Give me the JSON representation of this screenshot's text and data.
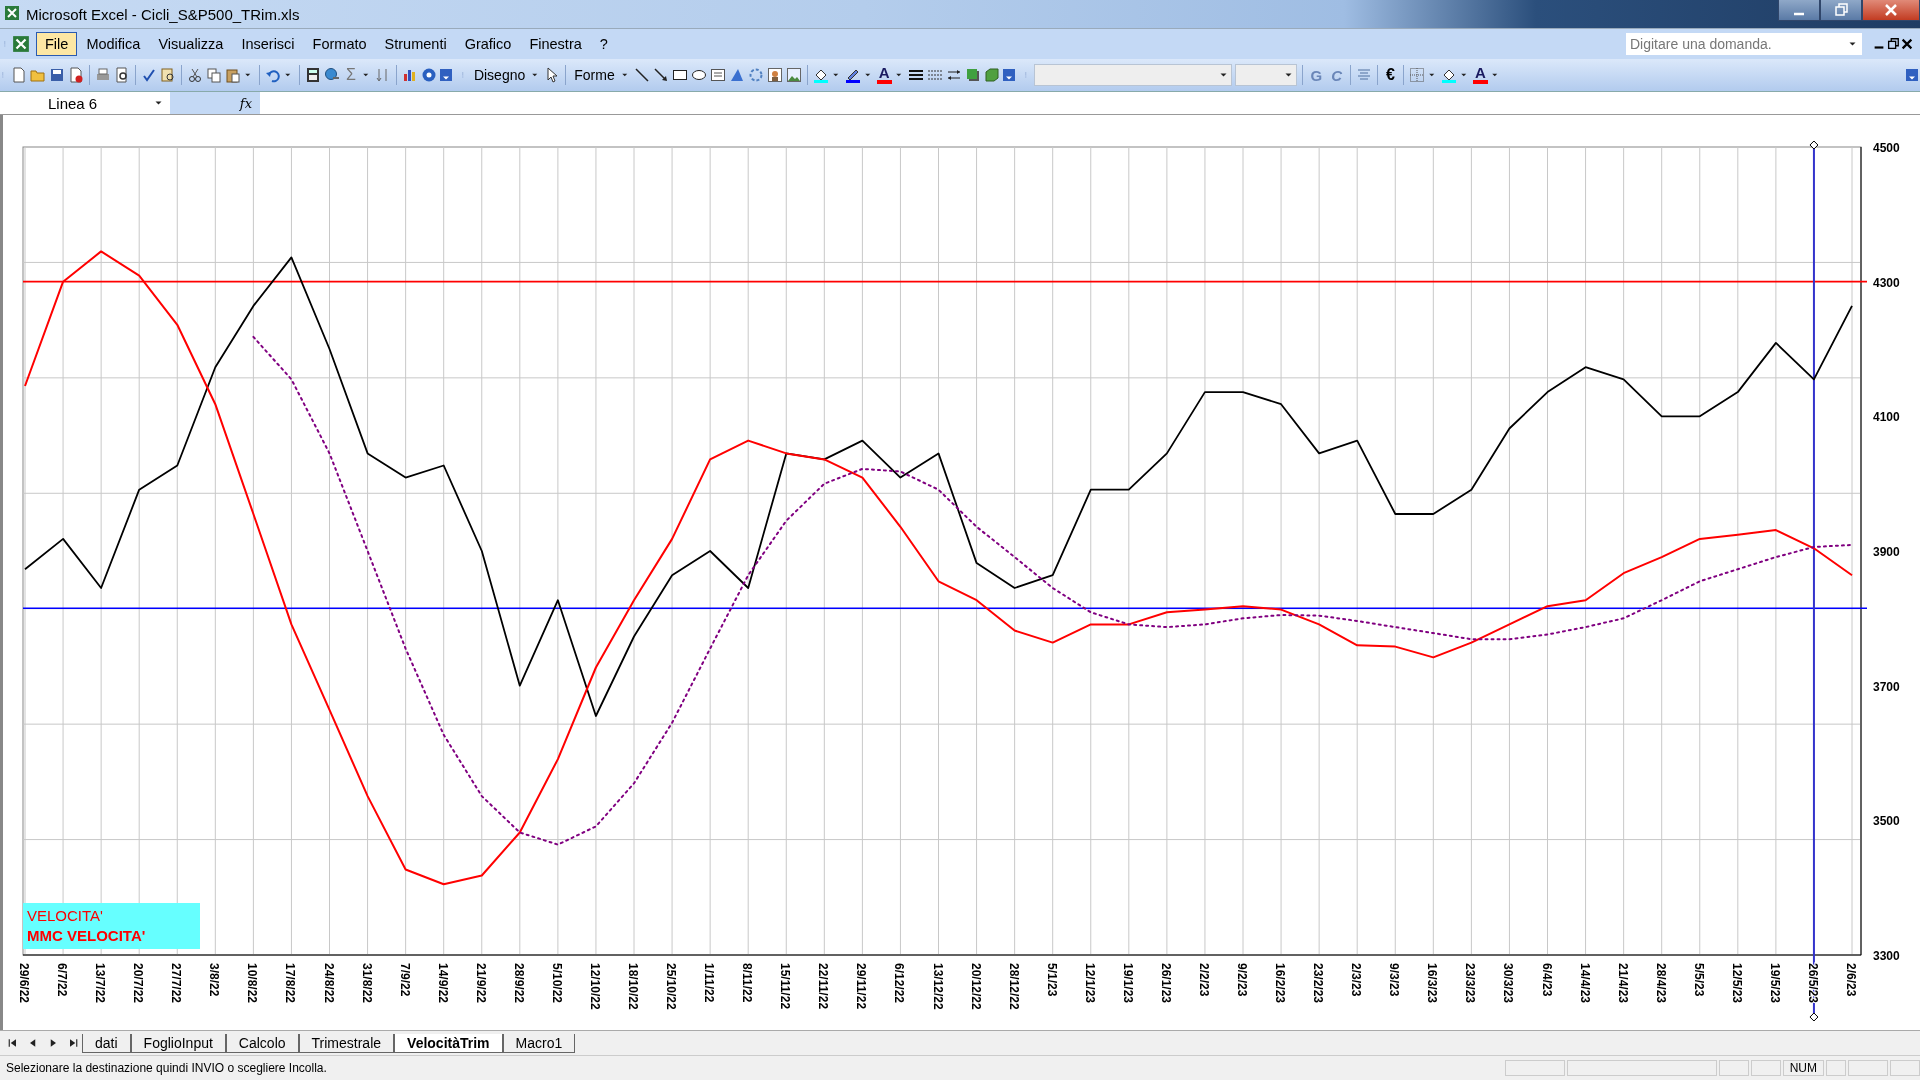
{
  "window": {
    "title": "Microsoft Excel - Cicli_S&P500_TRim.xls"
  },
  "menu_bar": {
    "items": [
      {
        "label": "File",
        "selected": true
      },
      {
        "label": "Modifica",
        "selected": false
      },
      {
        "label": "Visualizza",
        "selected": false
      },
      {
        "label": "Inserisci",
        "selected": false
      },
      {
        "label": "Formato",
        "selected": false
      },
      {
        "label": "Strumenti",
        "selected": false
      },
      {
        "label": "Grafico",
        "selected": false
      },
      {
        "label": "Finestra",
        "selected": false
      },
      {
        "label": "?",
        "selected": false
      }
    ],
    "help_box": {
      "placeholder": "Digitare una domanda."
    }
  },
  "toolbar": {
    "sum_symbol": "Σ",
    "drawing_menus": [
      "Disegno",
      "Forme"
    ],
    "drawing_font_color": "A",
    "format_buttons": [
      "G",
      "C"
    ],
    "euro": "€",
    "format_font_color": "A"
  },
  "formula_bar": {
    "name_box": "Linea 6",
    "fx": "fx"
  },
  "chart": {
    "chart_data": {
      "type": "line",
      "categories": [
        "29/6/22",
        "6/7/22",
        "13/7/22",
        "20/7/22",
        "27/7/22",
        "3/8/22",
        "10/8/22",
        "17/8/22",
        "24/8/22",
        "31/8/22",
        "7/9/22",
        "14/9/22",
        "21/9/22",
        "28/9/22",
        "5/10/22",
        "12/10/22",
        "18/10/22",
        "25/10/22",
        "1/11/22",
        "8/11/22",
        "15/11/22",
        "22/11/22",
        "29/11/22",
        "6/12/22",
        "13/12/22",
        "20/12/22",
        "28/12/22",
        "5/1/23",
        "12/1/23",
        "19/1/23",
        "26/1/23",
        "2/2/23",
        "9/2/23",
        "16/2/23",
        "23/2/23",
        "2/3/23",
        "9/3/23",
        "16/3/23",
        "23/3/23",
        "30/3/23",
        "6/4/23",
        "14/4/23",
        "21/4/23",
        "28/4/23",
        "5/5/23",
        "12/5/23",
        "19/5/23",
        "26/5/23",
        "2/6/23"
      ],
      "series": [
        {
          "color": "#000000",
          "values": [
            3873,
            3918,
            3845,
            3991,
            4027,
            4173,
            4264,
            4336,
            4200,
            4045,
            4009,
            4027,
            3900,
            3700,
            3827,
            3655,
            3773,
            3864,
            3900,
            3845,
            4045,
            4036,
            4064,
            4009,
            4045,
            3882,
            3845,
            3864,
            3991,
            3991,
            4045,
            4136,
            4136,
            4118,
            4045,
            4064,
            3955,
            3955,
            3991,
            4082,
            4136,
            4173,
            4155,
            4100,
            4100,
            4136,
            4209,
            4155,
            4264
          ]
        },
        {
          "color": "#ff0000",
          "values": [
            4145,
            4300,
            4345,
            4309,
            4236,
            4118,
            3955,
            3791,
            3664,
            3536,
            3427,
            3405,
            3418,
            3482,
            3591,
            3727,
            3827,
            3918,
            4036,
            4064,
            4045,
            4036,
            4009,
            3936,
            3855,
            3827,
            3782,
            3764,
            3791,
            3791,
            3809,
            3813,
            3818,
            3813,
            3791,
            3760,
            3758,
            3742,
            3764,
            3791,
            3818,
            3827,
            3867,
            3891,
            3918,
            3924,
            3931,
            3904,
            3864
          ]
        },
        {
          "color": "#800080",
          "line_style": "dotted",
          "values": [
            null,
            null,
            null,
            null,
            null,
            null,
            4218,
            4155,
            4045,
            3900,
            3755,
            3627,
            3536,
            3482,
            3464,
            3491,
            3555,
            3645,
            3755,
            3864,
            3945,
            4000,
            4022,
            4018,
            3991,
            3936,
            3891,
            3845,
            3809,
            3791,
            3787,
            3791,
            3800,
            3805,
            3804,
            3796,
            3787,
            3778,
            3769,
            3769,
            3776,
            3787,
            3800,
            3827,
            3855,
            3873,
            3891,
            3906,
            3909
          ]
        }
      ],
      "ylim": [
        3300,
        4500
      ],
      "yticks": [
        3300,
        3500,
        3700,
        3900,
        4100,
        4300,
        4500
      ],
      "grid": true,
      "ref_lines": [
        {
          "axis": "y",
          "value": 4300,
          "color": "#ff0000"
        },
        {
          "axis": "y",
          "value": 3815,
          "color": "#0000ff"
        },
        {
          "axis": "x",
          "value": "26/5/23",
          "color": "#3333cc"
        }
      ]
    },
    "legend": [
      {
        "label": "VELOCITA'",
        "bold": false
      },
      {
        "label": "MMC VELOCITA'",
        "bold": true
      }
    ]
  },
  "sheet_tabs": [
    {
      "label": "dati",
      "selected": false
    },
    {
      "label": "FoglioInput",
      "selected": false
    },
    {
      "label": "Calcolo",
      "selected": false
    },
    {
      "label": "Trimestrale",
      "selected": false
    },
    {
      "label": "VelocitàTrim",
      "selected": true
    },
    {
      "label": "Macro1",
      "selected": false
    }
  ],
  "status_bar": {
    "message": "Selezionare la destinazione quindi INVIO o scegliere Incolla.",
    "indicators": [
      "NUM"
    ]
  }
}
